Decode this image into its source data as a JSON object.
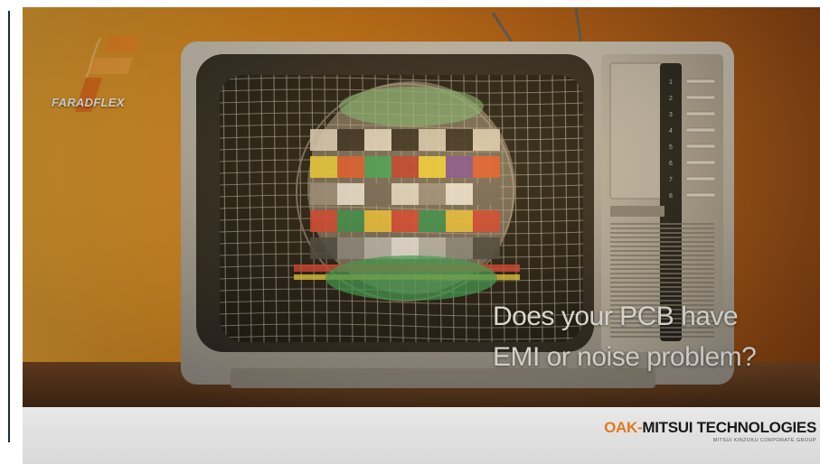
{
  "logo": {
    "text": "FARADFLEX",
    "icon": "faradflex-logo-icon"
  },
  "headline": {
    "line1": "Does your PCB have",
    "line2": "EMI or noise problem?"
  },
  "tv": {
    "channel_numbers": [
      "1",
      "2",
      "3",
      "4",
      "5",
      "6",
      "7",
      "8"
    ]
  },
  "footer": {
    "brand_prefix": "OAK-",
    "brand_rest": "MITSUI TECHNOLOGIES",
    "brand_sub": "MITSUI KINZOKU CORPORATE GROUP"
  },
  "colors": {
    "background_orange": "#d07a15",
    "brand_orange": "#e07a1d",
    "text_white": "#ffffff"
  }
}
